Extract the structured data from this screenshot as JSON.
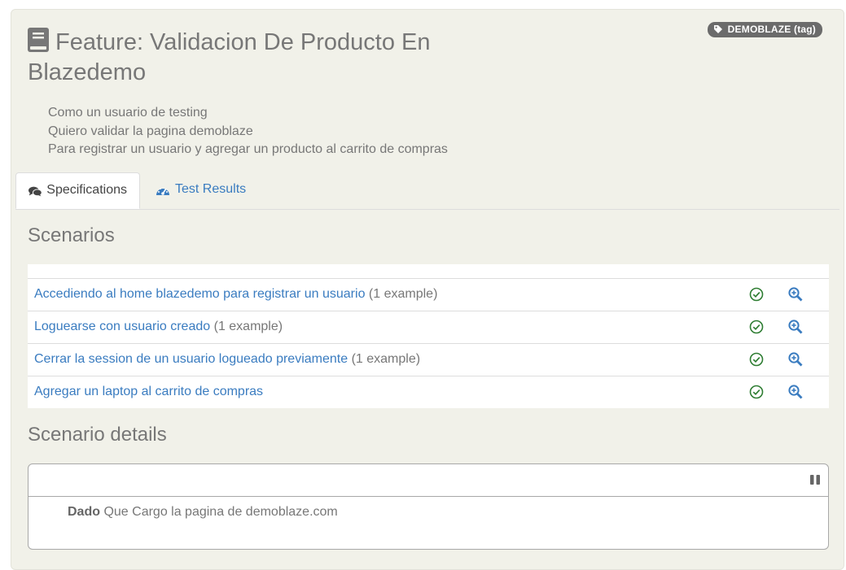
{
  "tag": {
    "label": "DEMOBLAZE (tag)"
  },
  "feature": {
    "title": "Feature: Validacion De Producto En Blazedemo",
    "narrative": [
      "Como un usuario de testing",
      "Quiero validar la pagina demoblaze",
      "Para registrar un usuario y agregar un producto al carrito de compras"
    ]
  },
  "tabs": [
    {
      "label": "Specifications",
      "icon": "comments-icon",
      "active": true
    },
    {
      "label": "Test Results",
      "icon": "dashboard-icon",
      "active": false
    }
  ],
  "scenarios": {
    "heading": "Scenarios",
    "rows": [
      {
        "name": "Accediendo al home blazedemo para registrar un usuario",
        "examples": "(1 example)",
        "status": "passed"
      },
      {
        "name": "Loguearse con usuario creado",
        "examples": "(1 example)",
        "status": "passed"
      },
      {
        "name": "Cerrar la session de un usuario logueado previamente",
        "examples": "(1 example)",
        "status": "passed"
      },
      {
        "name": "Agregar un laptop al carrito de compras",
        "examples": "",
        "status": "passed"
      }
    ]
  },
  "details": {
    "heading": "Scenario details",
    "step_keyword": "Dado",
    "step_text": " Que Cargo la pagina de demoblaze.com"
  },
  "colors": {
    "link": "#3a7cc0",
    "passed": "#2e7d32",
    "panel": "#f1f1e9"
  }
}
